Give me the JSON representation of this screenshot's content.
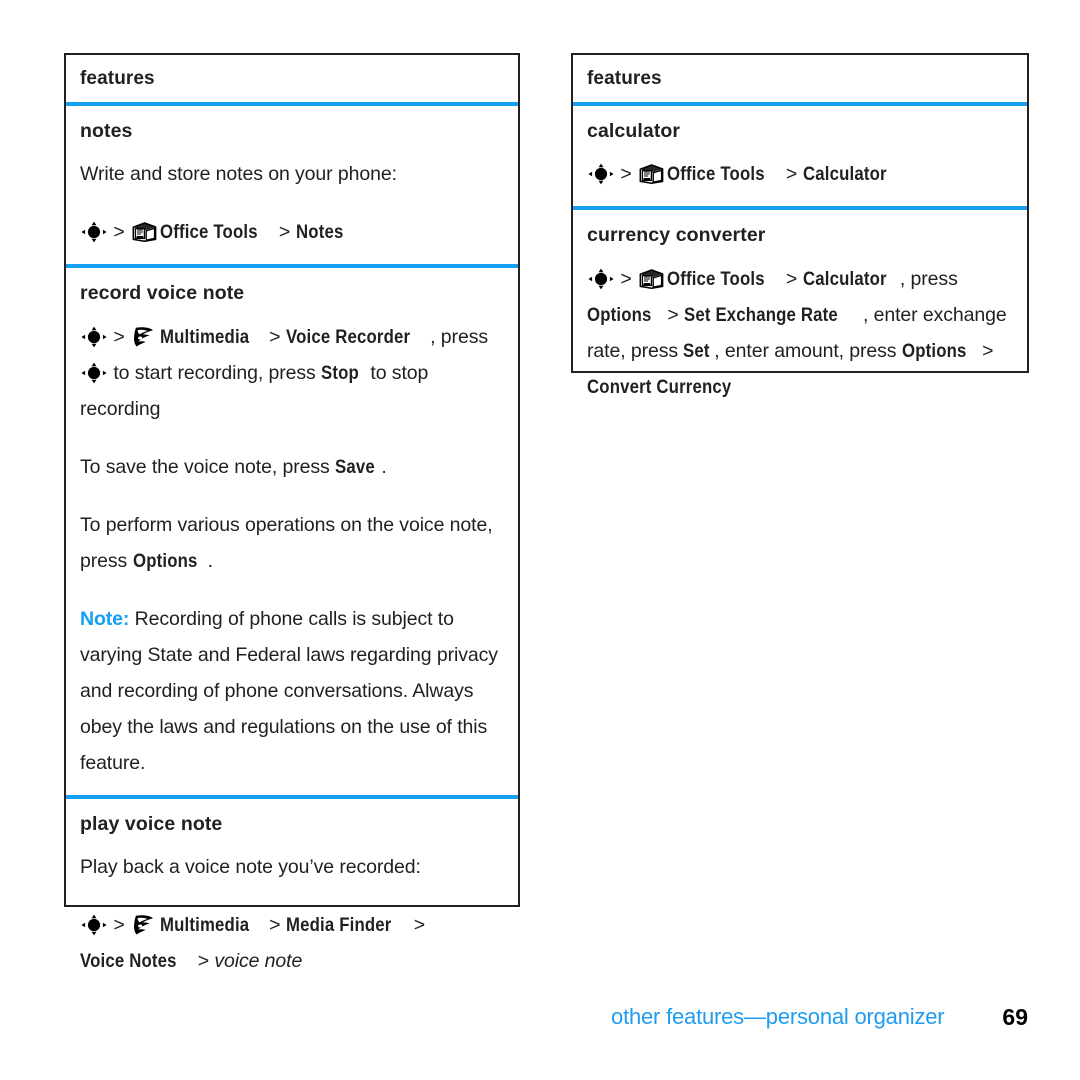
{
  "document": {
    "kind": "phone-user-guide-page",
    "accent_color": "#14a0f5",
    "text_color": "#231f20"
  },
  "left_column": {
    "header": {
      "label": "features"
    },
    "sections": [
      {
        "title": "notes",
        "intro": "Write and store notes on your phone:",
        "path": {
          "nav_icon": "five-way-nav-icon",
          "sep1": ">",
          "app_icon": "office-tools-folder-icon",
          "app_label": "Office Tools",
          "sep2": ">",
          "target_label": "Notes"
        }
      },
      {
        "title": "record voice note",
        "path": {
          "nav_icon": "five-way-nav-icon",
          "sep1": ">",
          "app_icon": "multimedia-icon",
          "app_label": "Multimedia",
          "sep2": ">",
          "target_label": "Voice Recorder",
          "after_target": ", press ",
          "nav_icon2": "five-way-nav-icon",
          "tail_a": " to start recording, press ",
          "stop_label": "Stop",
          "tail_b": " to stop recording"
        },
        "paragraphs": [
          {
            "pre": "To save the voice note, press ",
            "ui": "Save",
            "post": "."
          },
          {
            "pre": "To perform various operations on the voice note, press ",
            "ui": "Options",
            "post": "."
          }
        ],
        "note": {
          "label": "Note:",
          "text": " Recording of phone calls is subject to varying State and Federal laws regarding privacy and recording of phone conversations. Always obey the laws and regulations on the use of this feature."
        }
      },
      {
        "title": "play voice note",
        "intro": "Play back a voice note you’ve recorded:",
        "path": {
          "nav_icon": "five-way-nav-icon",
          "sep1": ">",
          "app_icon": "multimedia-icon",
          "app_label": "Multimedia",
          "sep2": ">",
          "target_label": "Media Finder",
          "sep3": ">",
          "target_label2": "Voice Notes",
          "sep4": ">",
          "italic_target": "voice note"
        }
      }
    ]
  },
  "right_column": {
    "header": {
      "label": "features"
    },
    "sections": [
      {
        "title": "calculator",
        "path": {
          "nav_icon": "five-way-nav-icon",
          "sep1": ">",
          "app_icon": "office-tools-folder-icon",
          "app_label": "Office Tools",
          "sep2": ">",
          "target_label": "Calculator"
        }
      },
      {
        "title": "currency converter",
        "path": {
          "nav_icon": "five-way-nav-icon",
          "sep1": ">",
          "app_icon": "office-tools-folder-icon",
          "app_label": "Office Tools",
          "sep2": ">",
          "target_label": "Calculator",
          "t1": ", press ",
          "options_label": "Options",
          "sep3": ">",
          "exchange_label": "Set Exchange Rate",
          "t2": ", enter exchange rate, press ",
          "set_label": "Set",
          "t3": ", enter amount, press ",
          "options_label2": "Options",
          "sep4": ">",
          "convert_label": "Convert Currency"
        }
      }
    ]
  },
  "footer": {
    "breadcrumb": "other features—personal organizer",
    "page_number": "69"
  }
}
